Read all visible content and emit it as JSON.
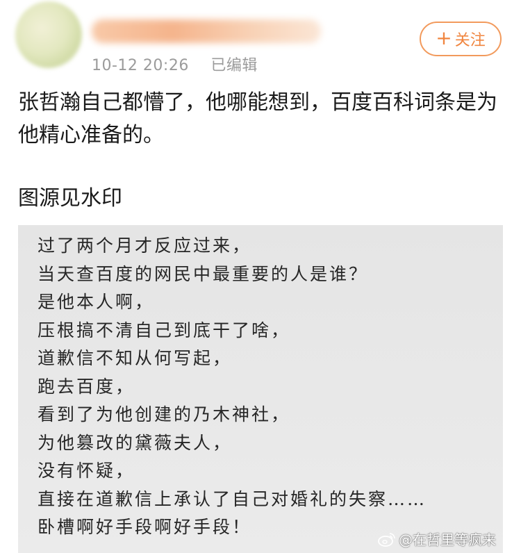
{
  "post": {
    "username": "",
    "timestamp": "10-12 20:26",
    "edited_label": "已编辑",
    "follow_label": "关注",
    "follow_icon": "+",
    "text": "张哲瀚自己都懵了，他哪能想到，百度百科词条是为他精心准备的。",
    "source_note": "图源见水印"
  },
  "image": {
    "lines": [
      "过了两个月才反应过来，",
      "当天查百度的网民中最重要的人是谁？",
      "是他本人啊，",
      "压根搞不清自己到底干了啥，",
      "道歉信不知从何写起，",
      "跑去百度，",
      "看到了为他创建的乃木神社，",
      "为他篡改的黛薇夫人，",
      "没有怀疑，",
      "直接在道歉信上承认了自己对婚礼的失察……",
      "卧槽啊好手段啊好手段！"
    ],
    "watermark": "@在哲里等疯来"
  },
  "colors": {
    "accent": "#f0853f",
    "meta_gray": "#9b9b9b",
    "image_bg": "#e8e8e8"
  }
}
